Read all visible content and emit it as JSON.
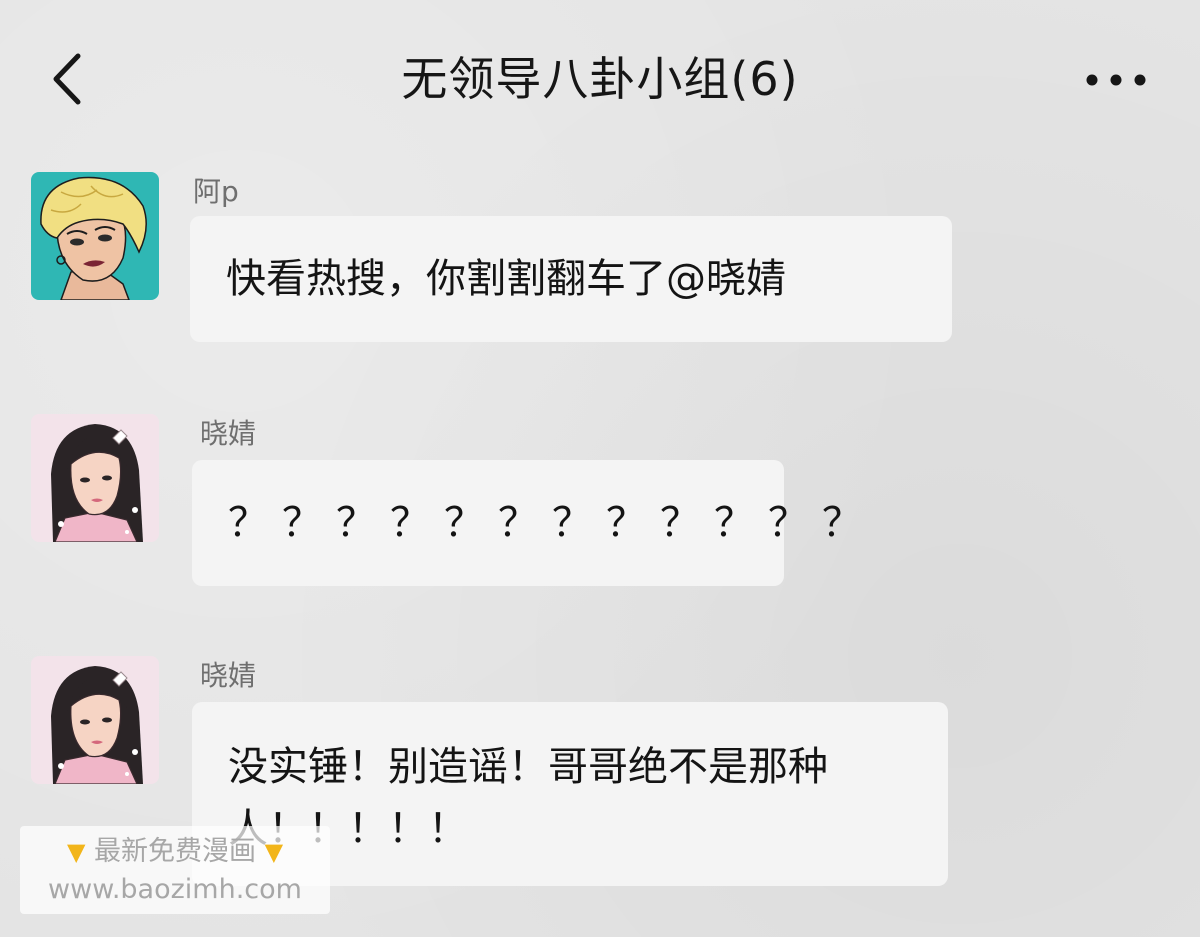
{
  "header": {
    "title": "无领导八卦小组(6)",
    "back_icon": "chevron-left-icon",
    "more_icon": "more-dots-icon"
  },
  "messages": [
    {
      "sender": "阿p",
      "text": "快看热搜，你割割翻车了@晓婧",
      "avatar": "blonde-woman-avatar"
    },
    {
      "sender": "晓婧",
      "text": "？？？？？？？？？？？？",
      "avatar": "dark-hair-woman-avatar"
    },
    {
      "sender": "晓婧",
      "text": "没实锤！别造谣！哥哥绝不是那种人！！！！！",
      "avatar": "dark-hair-woman-avatar"
    }
  ],
  "watermark": {
    "line1": "最新免费漫画",
    "line2": "www.baozimh.com",
    "hand_icon": "pointing-down-hand-icon"
  },
  "colors": {
    "background": "#e4e4e4",
    "bubble": "#f4f4f4",
    "title": "#161616",
    "sender": "#6f6f6f",
    "avatar1_bg": "#2fb7b4",
    "avatar2_bg": "#f3e3ea"
  }
}
